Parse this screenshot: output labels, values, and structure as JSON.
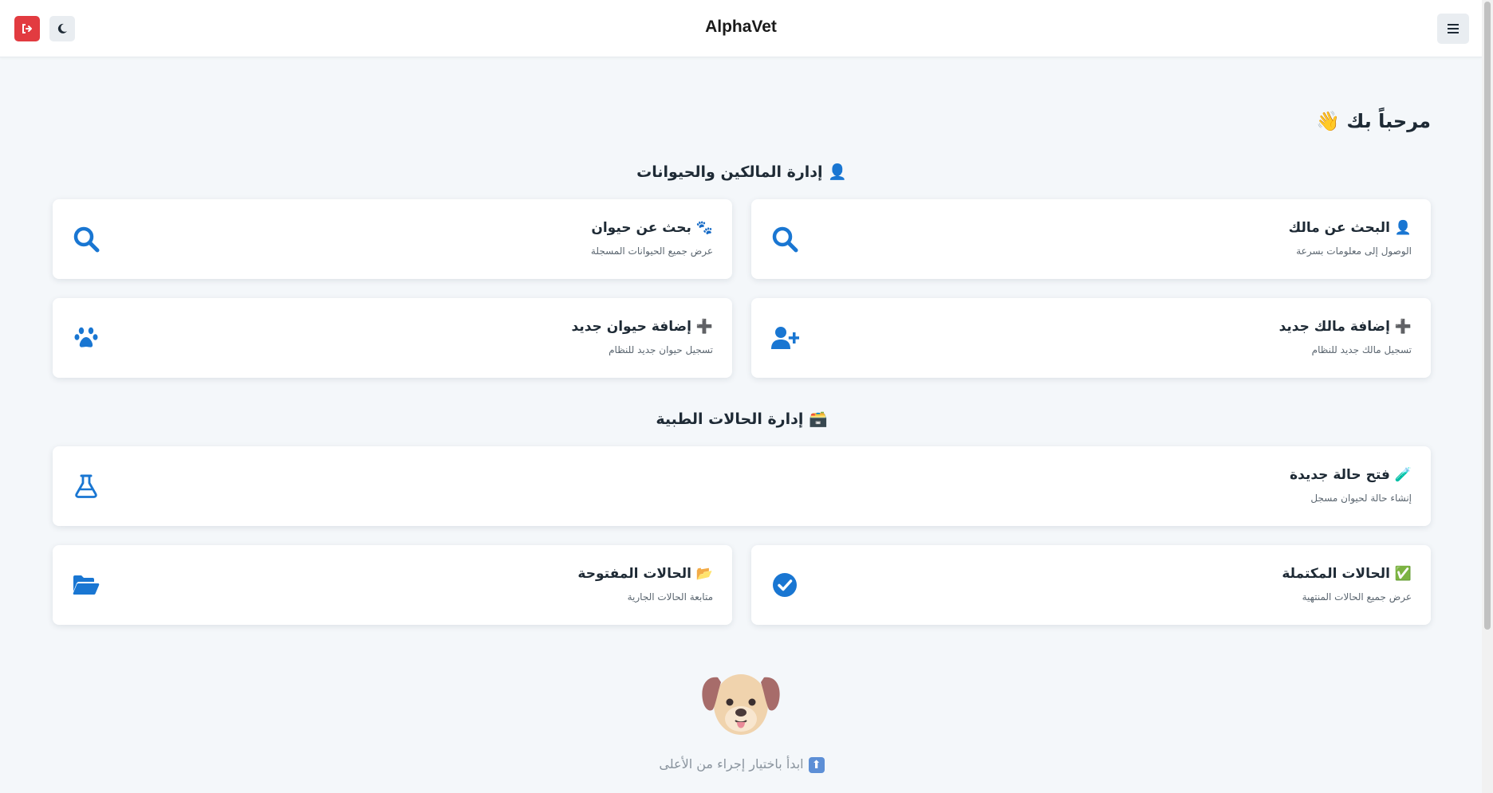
{
  "app": {
    "title": "AlphaVet"
  },
  "header": {
    "logout_icon": "logout-icon",
    "theme_icon": "moon-icon",
    "menu_icon": "hamburger-menu-icon"
  },
  "welcome": {
    "text": "مرحباً بك 👋"
  },
  "sections": {
    "owners_animals": {
      "title": "👤 إدارة المالكين والحيوانات"
    },
    "medical_cases": {
      "title": "🗃️ إدارة الحالات الطبية"
    }
  },
  "cards": {
    "search_owner": {
      "title": "👤 البحث عن مالك",
      "subtitle": "الوصول إلى معلومات بسرعة",
      "icon": "search-icon"
    },
    "search_animal": {
      "title": "🐾 بحث عن حيوان",
      "subtitle": "عرض جميع الحيوانات المسجلة",
      "icon": "search-icon"
    },
    "add_owner": {
      "title": "➕ إضافة مالك جديد",
      "subtitle": "تسجيل مالك جديد للنظام",
      "icon": "user-plus-icon"
    },
    "add_animal": {
      "title": "➕ إضافة حيوان جديد",
      "subtitle": "تسجيل حيوان جديد للنظام",
      "icon": "paw-icon"
    },
    "open_case": {
      "title": "🧪 فتح حالة جديدة",
      "subtitle": "إنشاء حالة لحيوان مسجل",
      "icon": "flask-icon"
    },
    "completed_cases": {
      "title": "✅ الحالات المكتملة",
      "subtitle": "عرض جميع الحالات المنتهية",
      "icon": "check-circle-icon"
    },
    "open_cases": {
      "title": "📂 الحالات المفتوحة",
      "subtitle": "متابعة الحالات الجارية",
      "icon": "folder-open-icon"
    }
  },
  "footer_hint": {
    "text": "ابدأ باختيار إجراء من الأعلى",
    "arrow": "⬆"
  },
  "colors": {
    "accent": "#1976d2",
    "danger": "#e23b40",
    "background": "#f4f7fa"
  }
}
